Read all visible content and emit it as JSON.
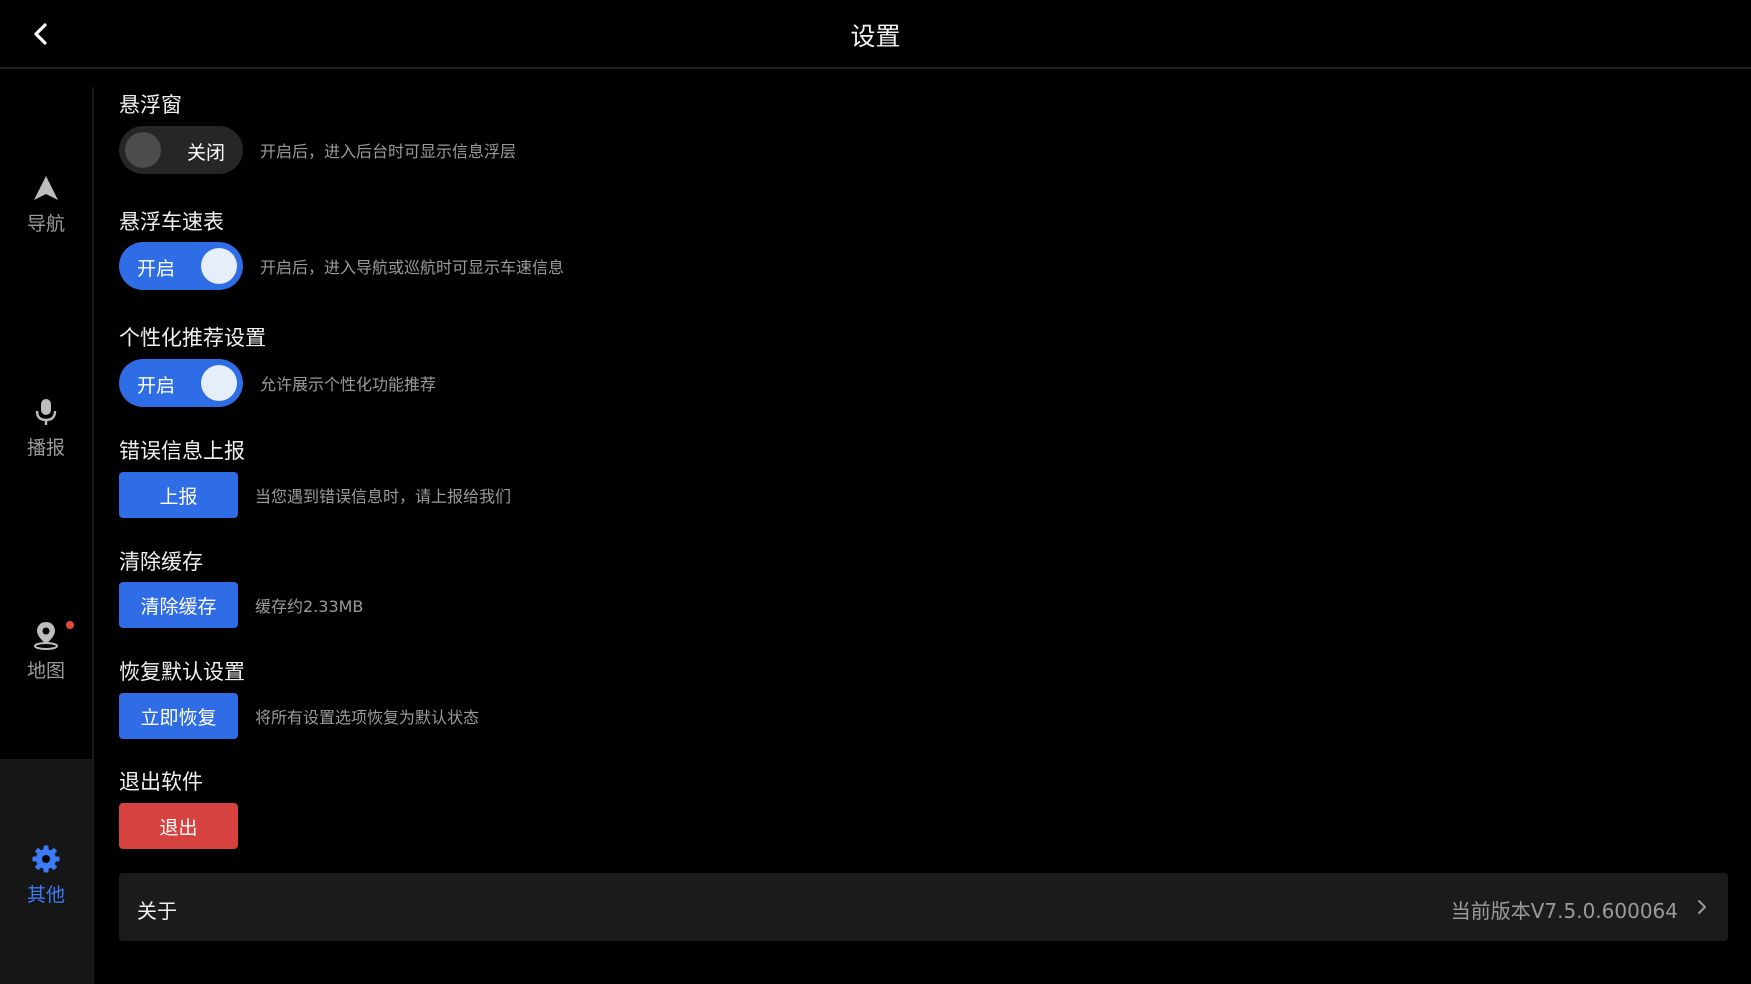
{
  "header": {
    "title": "设置"
  },
  "sidebar": {
    "items": [
      {
        "label": "导航",
        "icon": "navigation-arrow-icon"
      },
      {
        "label": "播报",
        "icon": "microphone-icon"
      },
      {
        "label": "地图",
        "icon": "map-pin-icon",
        "badge": "red-dot"
      },
      {
        "label": "其他",
        "icon": "gear-icon",
        "active": true
      }
    ]
  },
  "settings": {
    "floating_window": {
      "title": "悬浮窗",
      "toggle_state": "off",
      "toggle_label": "关闭",
      "desc": "开启后，进入后台时可显示信息浮层"
    },
    "floating_speedometer": {
      "title": "悬浮车速表",
      "toggle_state": "on",
      "toggle_label": "开启",
      "desc": "开启后，进入导航或巡航时可显示车速信息"
    },
    "personalized": {
      "title": "个性化推荐设置",
      "toggle_state": "on",
      "toggle_label": "开启",
      "desc": "允许展示个性化功能推荐"
    },
    "error_report": {
      "title": "错误信息上报",
      "button": "上报",
      "desc": "当您遇到错误信息时，请上报给我们"
    },
    "clear_cache": {
      "title": "清除缓存",
      "button": "清除缓存",
      "desc": "缓存约2.33MB"
    },
    "restore_default": {
      "title": "恢复默认设置",
      "button": "立即恢复",
      "desc": "将所有设置选项恢复为默认状态"
    },
    "exit": {
      "title": "退出软件",
      "button": "退出"
    }
  },
  "about": {
    "label": "关于",
    "version": "当前版本V7.5.0.600064"
  },
  "colors": {
    "accent_blue": "#2f6de6",
    "danger_red": "#d6423f",
    "background": "#000000",
    "active_nav": "#3b7cf5"
  }
}
